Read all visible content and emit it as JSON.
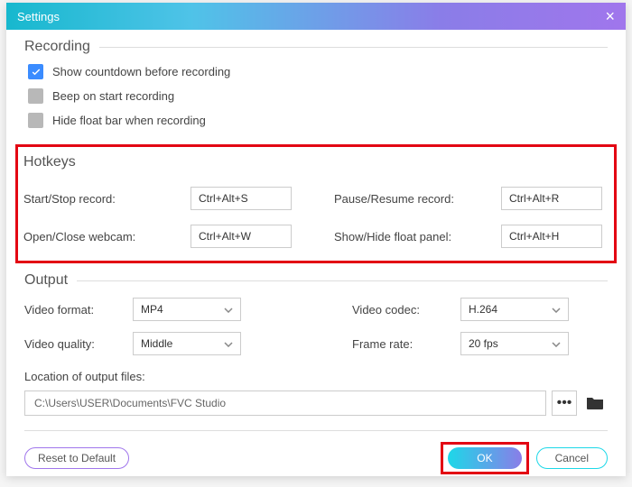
{
  "window": {
    "title": "Settings"
  },
  "recording": {
    "heading": "Recording",
    "items": [
      {
        "label": "Show countdown before recording",
        "checked": true
      },
      {
        "label": "Beep on start recording",
        "checked": false
      },
      {
        "label": "Hide float bar when recording",
        "checked": false
      }
    ]
  },
  "hotkeys": {
    "heading": "Hotkeys",
    "start_stop": {
      "label": "Start/Stop record:",
      "value": "Ctrl+Alt+S"
    },
    "pause_resume": {
      "label": "Pause/Resume record:",
      "value": "Ctrl+Alt+R"
    },
    "open_close_webcam": {
      "label": "Open/Close webcam:",
      "value": "Ctrl+Alt+W"
    },
    "show_hide_float": {
      "label": "Show/Hide float panel:",
      "value": "Ctrl+Alt+H"
    }
  },
  "output": {
    "heading": "Output",
    "video_format": {
      "label": "Video format:",
      "value": "MP4"
    },
    "video_codec": {
      "label": "Video codec:",
      "value": "H.264"
    },
    "video_quality": {
      "label": "Video quality:",
      "value": "Middle"
    },
    "frame_rate": {
      "label": "Frame rate:",
      "value": "20 fps"
    },
    "location_label": "Location of output files:",
    "location_path": "C:\\Users\\USER\\Documents\\FVC Studio"
  },
  "footer": {
    "reset": "Reset to Default",
    "ok": "OK",
    "cancel": "Cancel"
  },
  "icons": {
    "more": "•••"
  }
}
